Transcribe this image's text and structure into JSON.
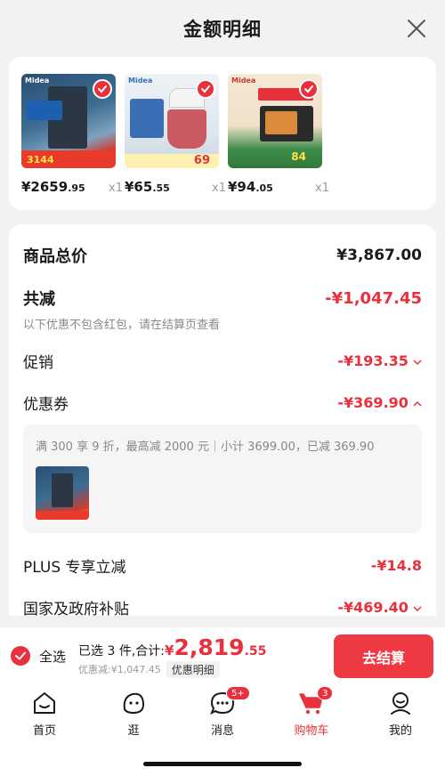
{
  "header": {
    "title": "金额明细"
  },
  "products": [
    {
      "price_int": "¥2659",
      "price_dec": ".95",
      "qty": "x1",
      "brand": "Midea",
      "img_price": "3144"
    },
    {
      "price_int": "¥65",
      "price_dec": ".55",
      "qty": "x1",
      "brand": "Midea",
      "img_price": "69"
    },
    {
      "price_int": "¥94",
      "price_dec": ".05",
      "qty": "x1",
      "brand": "Midea",
      "img_price": "84"
    }
  ],
  "summary": {
    "total_label": "商品总价",
    "total_value": "¥3,867.00",
    "discount_label": "共减",
    "discount_value": "-¥1,047.45",
    "discount_note": "以下优惠不包含红包，请在结算页查看",
    "promo_label": "促销",
    "promo_value": "-¥193.35",
    "coupon_label": "优惠券",
    "coupon_value": "-¥369.90",
    "coupon_desc": "满 300 享 9 折，最高减 2000 元｜小计 3699.00，已减 369.90",
    "plus_label": "PLUS 专享立减",
    "plus_value": "-¥14.8",
    "subsidy_label": "国家及政府补贴",
    "subsidy_value": "-¥469.40"
  },
  "footer": {
    "select_all": "全选",
    "selected_text": "已选 3 件,合计:",
    "total_yen": "¥",
    "total_int": "2,819",
    "total_dec": ".55",
    "saved_text": "优惠减:¥1,047.45",
    "detail_tag": "优惠明细",
    "checkout_label": "去结算"
  },
  "tabbar": {
    "home": "首页",
    "browse": "逛",
    "messages": "消息",
    "messages_badge": "5+",
    "cart": "购物车",
    "cart_badge": "3",
    "me": "我的"
  },
  "colors": {
    "accent": "#e8313d",
    "checkout": "#f03a43"
  },
  "icons": [
    "close-icon",
    "check-icon",
    "home-icon",
    "browse-face-icon",
    "message-bubble-icon",
    "cart-icon",
    "user-icon",
    "chevron-down-icon",
    "chevron-up-icon"
  ]
}
